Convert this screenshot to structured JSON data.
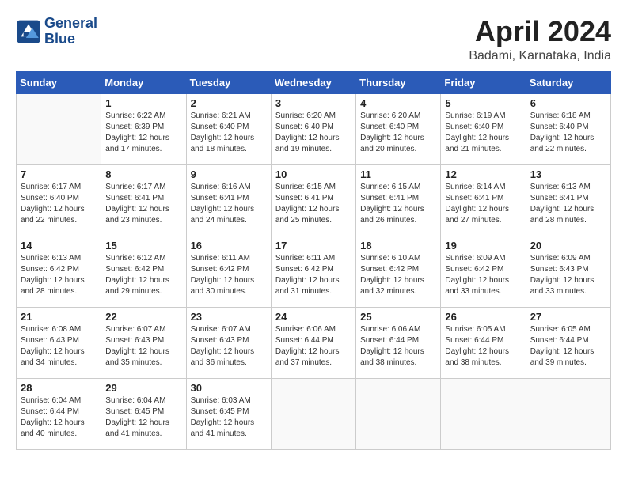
{
  "header": {
    "logo_line1": "General",
    "logo_line2": "Blue",
    "month_title": "April 2024",
    "location": "Badami, Karnataka, India"
  },
  "weekdays": [
    "Sunday",
    "Monday",
    "Tuesday",
    "Wednesday",
    "Thursday",
    "Friday",
    "Saturday"
  ],
  "weeks": [
    [
      {
        "day": "",
        "info": ""
      },
      {
        "day": "1",
        "info": "Sunrise: 6:22 AM\nSunset: 6:39 PM\nDaylight: 12 hours\nand 17 minutes."
      },
      {
        "day": "2",
        "info": "Sunrise: 6:21 AM\nSunset: 6:40 PM\nDaylight: 12 hours\nand 18 minutes."
      },
      {
        "day": "3",
        "info": "Sunrise: 6:20 AM\nSunset: 6:40 PM\nDaylight: 12 hours\nand 19 minutes."
      },
      {
        "day": "4",
        "info": "Sunrise: 6:20 AM\nSunset: 6:40 PM\nDaylight: 12 hours\nand 20 minutes."
      },
      {
        "day": "5",
        "info": "Sunrise: 6:19 AM\nSunset: 6:40 PM\nDaylight: 12 hours\nand 21 minutes."
      },
      {
        "day": "6",
        "info": "Sunrise: 6:18 AM\nSunset: 6:40 PM\nDaylight: 12 hours\nand 22 minutes."
      }
    ],
    [
      {
        "day": "7",
        "info": "Sunrise: 6:17 AM\nSunset: 6:40 PM\nDaylight: 12 hours\nand 22 minutes."
      },
      {
        "day": "8",
        "info": "Sunrise: 6:17 AM\nSunset: 6:41 PM\nDaylight: 12 hours\nand 23 minutes."
      },
      {
        "day": "9",
        "info": "Sunrise: 6:16 AM\nSunset: 6:41 PM\nDaylight: 12 hours\nand 24 minutes."
      },
      {
        "day": "10",
        "info": "Sunrise: 6:15 AM\nSunset: 6:41 PM\nDaylight: 12 hours\nand 25 minutes."
      },
      {
        "day": "11",
        "info": "Sunrise: 6:15 AM\nSunset: 6:41 PM\nDaylight: 12 hours\nand 26 minutes."
      },
      {
        "day": "12",
        "info": "Sunrise: 6:14 AM\nSunset: 6:41 PM\nDaylight: 12 hours\nand 27 minutes."
      },
      {
        "day": "13",
        "info": "Sunrise: 6:13 AM\nSunset: 6:41 PM\nDaylight: 12 hours\nand 28 minutes."
      }
    ],
    [
      {
        "day": "14",
        "info": "Sunrise: 6:13 AM\nSunset: 6:42 PM\nDaylight: 12 hours\nand 28 minutes."
      },
      {
        "day": "15",
        "info": "Sunrise: 6:12 AM\nSunset: 6:42 PM\nDaylight: 12 hours\nand 29 minutes."
      },
      {
        "day": "16",
        "info": "Sunrise: 6:11 AM\nSunset: 6:42 PM\nDaylight: 12 hours\nand 30 minutes."
      },
      {
        "day": "17",
        "info": "Sunrise: 6:11 AM\nSunset: 6:42 PM\nDaylight: 12 hours\nand 31 minutes."
      },
      {
        "day": "18",
        "info": "Sunrise: 6:10 AM\nSunset: 6:42 PM\nDaylight: 12 hours\nand 32 minutes."
      },
      {
        "day": "19",
        "info": "Sunrise: 6:09 AM\nSunset: 6:42 PM\nDaylight: 12 hours\nand 33 minutes."
      },
      {
        "day": "20",
        "info": "Sunrise: 6:09 AM\nSunset: 6:43 PM\nDaylight: 12 hours\nand 33 minutes."
      }
    ],
    [
      {
        "day": "21",
        "info": "Sunrise: 6:08 AM\nSunset: 6:43 PM\nDaylight: 12 hours\nand 34 minutes."
      },
      {
        "day": "22",
        "info": "Sunrise: 6:07 AM\nSunset: 6:43 PM\nDaylight: 12 hours\nand 35 minutes."
      },
      {
        "day": "23",
        "info": "Sunrise: 6:07 AM\nSunset: 6:43 PM\nDaylight: 12 hours\nand 36 minutes."
      },
      {
        "day": "24",
        "info": "Sunrise: 6:06 AM\nSunset: 6:44 PM\nDaylight: 12 hours\nand 37 minutes."
      },
      {
        "day": "25",
        "info": "Sunrise: 6:06 AM\nSunset: 6:44 PM\nDaylight: 12 hours\nand 38 minutes."
      },
      {
        "day": "26",
        "info": "Sunrise: 6:05 AM\nSunset: 6:44 PM\nDaylight: 12 hours\nand 38 minutes."
      },
      {
        "day": "27",
        "info": "Sunrise: 6:05 AM\nSunset: 6:44 PM\nDaylight: 12 hours\nand 39 minutes."
      }
    ],
    [
      {
        "day": "28",
        "info": "Sunrise: 6:04 AM\nSunset: 6:44 PM\nDaylight: 12 hours\nand 40 minutes."
      },
      {
        "day": "29",
        "info": "Sunrise: 6:04 AM\nSunset: 6:45 PM\nDaylight: 12 hours\nand 41 minutes."
      },
      {
        "day": "30",
        "info": "Sunrise: 6:03 AM\nSunset: 6:45 PM\nDaylight: 12 hours\nand 41 minutes."
      },
      {
        "day": "",
        "info": ""
      },
      {
        "day": "",
        "info": ""
      },
      {
        "day": "",
        "info": ""
      },
      {
        "day": "",
        "info": ""
      }
    ]
  ]
}
